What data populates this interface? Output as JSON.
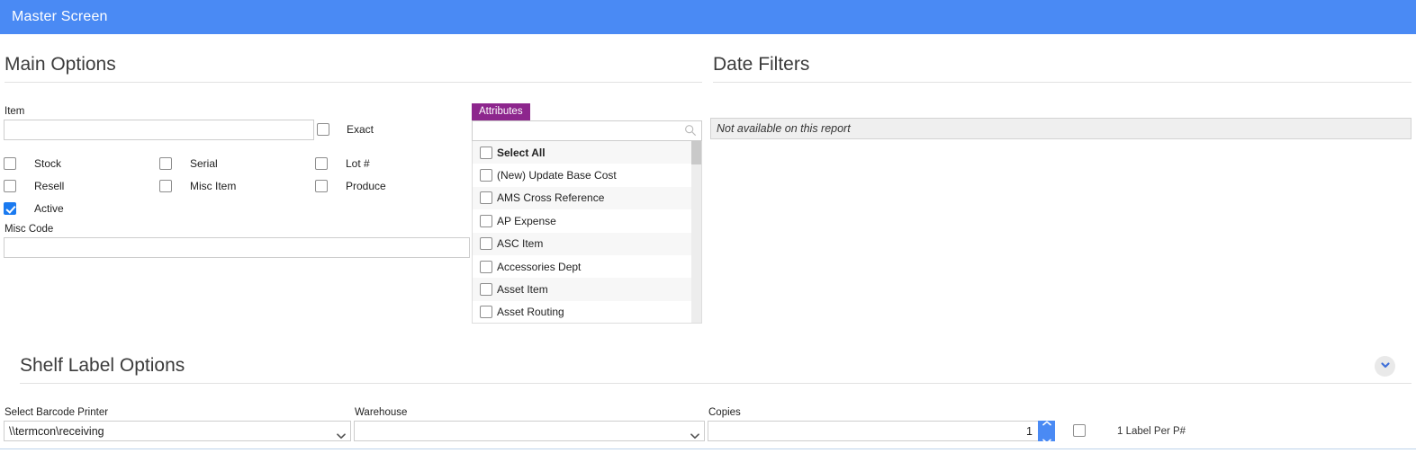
{
  "window": {
    "title": "Master Screen",
    "accent_color": "#4a8af4"
  },
  "sections": {
    "main_options": {
      "heading": "Main Options"
    },
    "date_filters": {
      "heading": "Date Filters",
      "note": "Not available on this report"
    },
    "shelf_label_options": {
      "heading": "Shelf Label Options"
    }
  },
  "main_options": {
    "item": {
      "label": "Item",
      "value": "",
      "placeholder": ""
    },
    "exact": {
      "label": "Exact",
      "checked": false
    },
    "checkboxes": [
      {
        "label": "Stock",
        "checked": false
      },
      {
        "label": "Serial",
        "checked": false
      },
      {
        "label": "Lot #",
        "checked": false
      },
      {
        "label": "Resell",
        "checked": false
      },
      {
        "label": "Misc Item",
        "checked": false
      },
      {
        "label": "Produce",
        "checked": false
      },
      {
        "label": "Active",
        "checked": true
      }
    ],
    "misc_code": {
      "label": "Misc Code",
      "value": "",
      "placeholder": ""
    }
  },
  "attributes": {
    "tab_label": "Attributes",
    "tab_color": "#8d268d",
    "search": {
      "value": "",
      "placeholder": ""
    },
    "items": [
      {
        "label": "Select All",
        "checked": false,
        "bold": true
      },
      {
        "label": "(New) Update Base Cost",
        "checked": false,
        "bold": false
      },
      {
        "label": "AMS Cross Reference",
        "checked": false,
        "bold": false
      },
      {
        "label": "AP Expense",
        "checked": false,
        "bold": false
      },
      {
        "label": "ASC Item",
        "checked": false,
        "bold": false
      },
      {
        "label": "Accessories Dept",
        "checked": false,
        "bold": false
      },
      {
        "label": "Asset Item",
        "checked": false,
        "bold": false
      },
      {
        "label": "Asset Routing",
        "checked": false,
        "bold": false
      }
    ]
  },
  "shelf_label_options": {
    "printer": {
      "label": "Select Barcode Printer",
      "value": "\\\\termcon\\receiving"
    },
    "warehouse": {
      "label": "Warehouse",
      "value": ""
    },
    "copies": {
      "label": "Copies",
      "value": "1"
    },
    "one_label_per_pn": {
      "label": "1 Label Per P#",
      "checked": false
    }
  }
}
